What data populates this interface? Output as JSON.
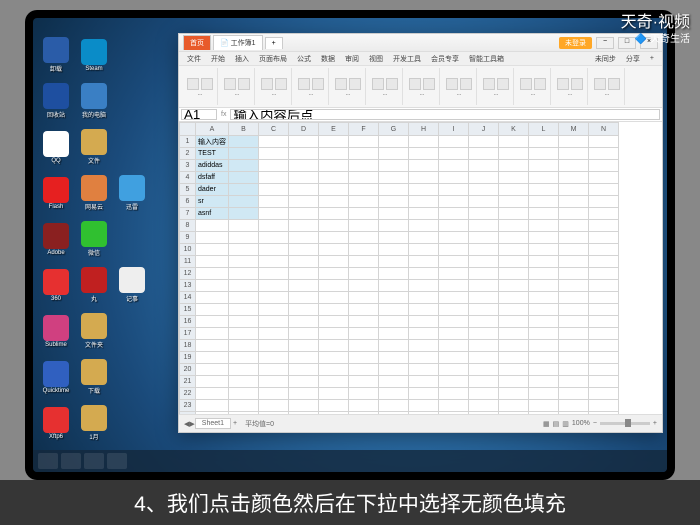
{
  "watermark": {
    "main": "天奇·视频",
    "sub": "天奇生活"
  },
  "caption": "4、我们点击颜色然后在下拉中选择无颜色填充",
  "desktop": {
    "icons": [
      [
        {
          "c": "#2a5ca8",
          "n": "卸载"
        },
        {
          "c": "#0a8cc8",
          "n": "Steam"
        }
      ],
      [
        {
          "c": "#1e4fa0",
          "n": "回收站"
        },
        {
          "c": "#3a7fc4",
          "n": "我的电脑"
        }
      ],
      [
        {
          "c": "#ffffff",
          "n": "QQ"
        },
        {
          "c": "#d4aa50",
          "n": "文件"
        }
      ],
      [
        {
          "c": "#e62020",
          "n": "Flash"
        },
        {
          "c": "#e08040",
          "n": "网易云"
        },
        {
          "c": "#40a0e0",
          "n": "迅雷"
        }
      ],
      [
        {
          "c": "#8a2020",
          "n": "Adobe"
        },
        {
          "c": "#30c030",
          "n": "微信"
        }
      ],
      [
        {
          "c": "#e63030",
          "n": "360"
        },
        {
          "c": "#c02020",
          "n": "丸"
        },
        {
          "c": "#eeeeee",
          "n": "记事"
        }
      ],
      [
        {
          "c": "#d04080",
          "n": "Sublime"
        },
        {
          "c": "#d4aa50",
          "n": "文件夹"
        }
      ],
      [
        {
          "c": "#3060c0",
          "n": "Quicktime"
        },
        {
          "c": "#d4aa50",
          "n": "下载"
        }
      ],
      [
        {
          "c": "#e63030",
          "n": "Xftp6"
        },
        {
          "c": "#d4aa50",
          "n": "1月"
        }
      ]
    ]
  },
  "wps": {
    "tabs": {
      "home": "首页",
      "active": "工作簿1"
    },
    "login": "未登录",
    "menu": [
      "文件",
      "开始",
      "插入",
      "页面布局",
      "公式",
      "数据",
      "审阅",
      "视图",
      "开发工具",
      "会员专享",
      "智能工具箱"
    ],
    "menu_right": [
      "未同步",
      "分享",
      "+"
    ],
    "name_box": "A1",
    "formula": "输入内容后点",
    "cells": {
      "A1": "输入内容",
      "A2": "TEST",
      "A3": "adiddas",
      "A4": "dsfaff",
      "A5": "dader",
      "A6": "sr",
      "A7": "asnf"
    },
    "sheet": "Sheet1",
    "status_left": "平均值=0",
    "zoom": "100%"
  }
}
